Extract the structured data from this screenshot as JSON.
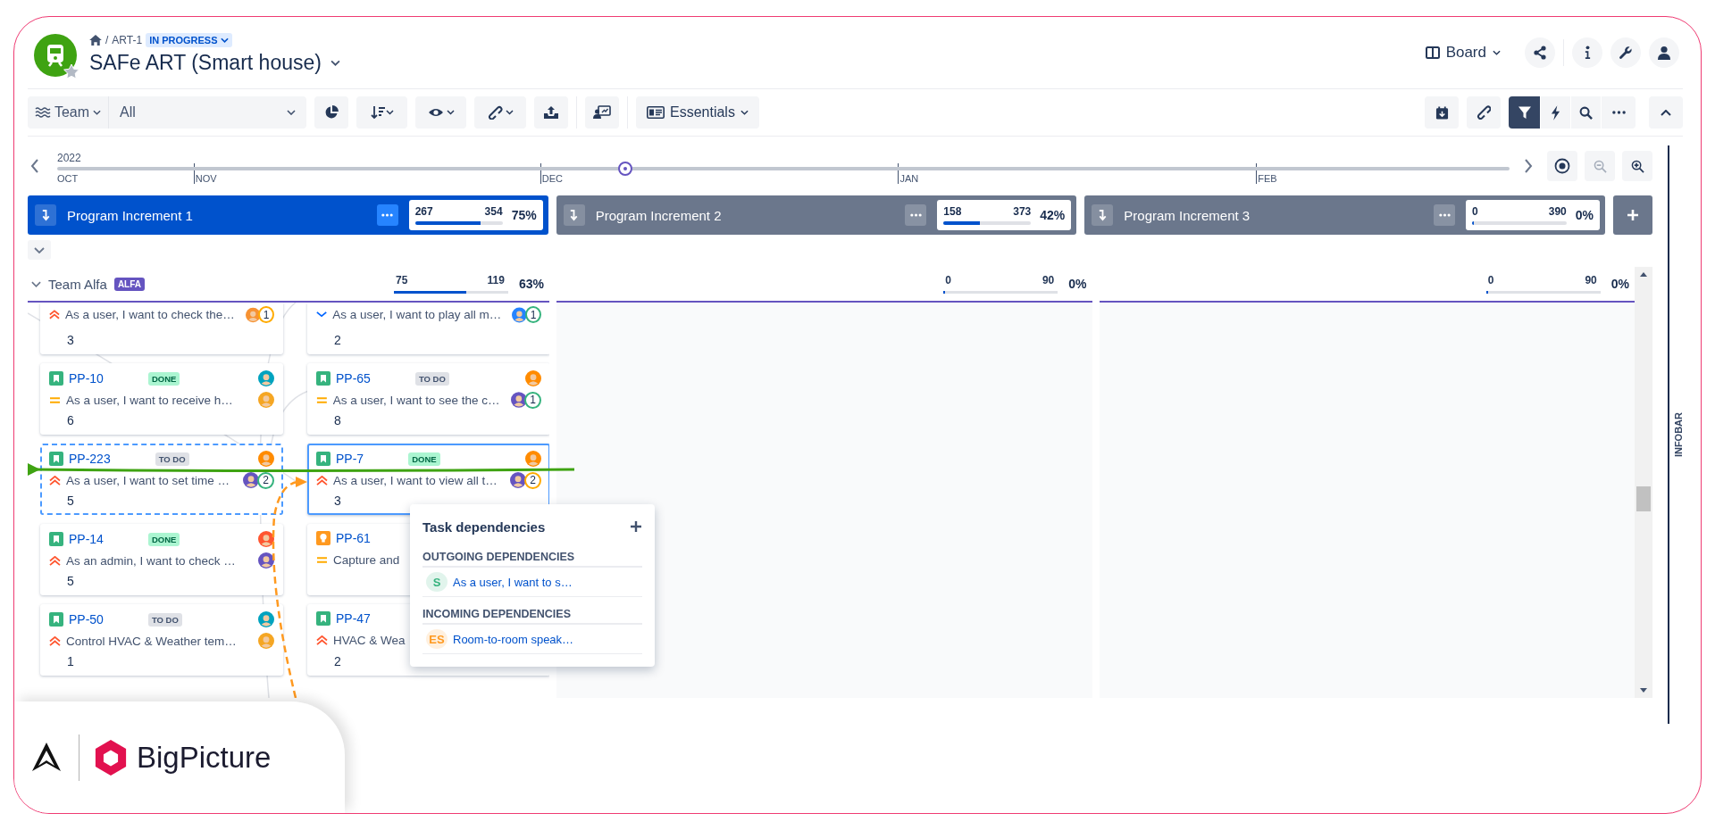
{
  "header": {
    "home_separator": "/",
    "breadcrumb": "ART-1",
    "status": "IN PROGRESS",
    "title": "SAFe ART (Smart house)",
    "view": "Board"
  },
  "toolbar": {
    "group_by": "Team",
    "filter_value": "All",
    "preset": "Essentials",
    "filter_on": true
  },
  "timeline": {
    "year": "2022",
    "months": [
      "OCT",
      "NOV",
      "DEC",
      "JAN",
      "FEB"
    ]
  },
  "increments": [
    {
      "title": "Program Increment 1",
      "done": "267",
      "total": "354",
      "percent": "75%",
      "level": 0.75,
      "selected": true
    },
    {
      "title": "Program Increment 2",
      "done": "158",
      "total": "373",
      "percent": "42%",
      "level": 0.42,
      "selected": false
    },
    {
      "title": "Program Increment 3",
      "done": "0",
      "total": "390",
      "percent": "0%",
      "level": 0,
      "selected": false
    }
  ],
  "team": {
    "name": "Team Alfa",
    "badge": "ALFA",
    "stats": [
      {
        "done": "75",
        "total": "119",
        "percent": "63%",
        "level": 0.63
      },
      {
        "done": "0",
        "total": "90",
        "percent": "0%",
        "level": 0
      },
      {
        "done": "0",
        "total": "90",
        "percent": "0%",
        "level": 0
      }
    ]
  },
  "columns": [
    {
      "cards": [
        {
          "priority": {
            "kind": "highest"
          },
          "summary": "As a user, I want to check the…",
          "points": "3",
          "line_avatar": {
            "color": "#f79232"
          },
          "badge": {
            "text": "1",
            "color": "#ffab00"
          },
          "selected": false,
          "marked": false
        },
        {
          "id": "PP-10",
          "kind": "story",
          "status": {
            "text": "DONE",
            "kind": "done"
          },
          "priority": {
            "kind": "medium"
          },
          "summary": "As a user, I want to receive h…",
          "points": "6",
          "head_avatar": {
            "color": "#00a3bf"
          },
          "line_avatar": {
            "color": "#f5a623"
          },
          "selected": false,
          "marked": false
        },
        {
          "id": "PP-223",
          "kind": "story",
          "status": {
            "text": "TO DO",
            "kind": "todo"
          },
          "priority": {
            "kind": "highest"
          },
          "summary": "As a user, I want to set time …",
          "points": "5",
          "head_avatar": {
            "color": "#ff8b00"
          },
          "line_avatar": {
            "color": "#6554c0"
          },
          "badge": {
            "text": "2",
            "color": "#36b37e"
          },
          "selected": false,
          "marked": true
        },
        {
          "id": "PP-14",
          "kind": "story",
          "status": {
            "text": "DONE",
            "kind": "done"
          },
          "priority": {
            "kind": "highest"
          },
          "summary": "As an admin, I want to check …",
          "points": "5",
          "head_avatar": {
            "color": "#ff5630"
          },
          "line_avatar": {
            "color": "#6554c0"
          },
          "selected": false,
          "marked": false
        },
        {
          "id": "PP-50",
          "kind": "story",
          "status": {
            "text": "TO DO",
            "kind": "todo"
          },
          "priority": {
            "kind": "highest"
          },
          "summary": "Control HVAC & Weather tem…",
          "points": "1",
          "head_avatar": {
            "color": "#00a3bf"
          },
          "line_avatar": {
            "color": "#f5a623"
          },
          "selected": false,
          "marked": false
        }
      ]
    },
    {
      "cards": [
        {
          "priority": {
            "kind": "low"
          },
          "summary": "As a user, I want to play all m…",
          "points": "2",
          "line_avatar": {
            "color": "#2684ff"
          },
          "badge": {
            "text": "1",
            "color": "#36b37e"
          },
          "selected": false,
          "marked": false
        },
        {
          "id": "PP-65",
          "kind": "story",
          "status": {
            "text": "TO DO",
            "kind": "todo"
          },
          "priority": {
            "kind": "medium"
          },
          "summary": "As a user, I want to see the c…",
          "points": "8",
          "head_avatar": {
            "color": "#ff8b00"
          },
          "line_avatar": {
            "color": "#6554c0"
          },
          "badge": {
            "text": "1",
            "color": "#36b37e"
          },
          "selected": false,
          "marked": false
        },
        {
          "id": "PP-7",
          "kind": "story",
          "status": {
            "text": "DONE",
            "kind": "done"
          },
          "priority": {
            "kind": "highest"
          },
          "summary": "As a user, I want to view all t…",
          "points": "3",
          "head_avatar": {
            "color": "#ff8b00"
          },
          "line_avatar": {
            "color": "#6554c0"
          },
          "badge": {
            "text": "2",
            "color": "#ffab00"
          },
          "selected": true,
          "marked": false
        },
        {
          "id": "PP-61",
          "kind": "idea",
          "priority": {
            "kind": "medium"
          },
          "summary": "Capture and",
          "selected": false,
          "marked": false
        },
        {
          "id": "PP-47",
          "kind": "story",
          "priority": {
            "kind": "highest"
          },
          "summary": "HVAC & Wea",
          "points": "2",
          "selected": false,
          "marked": false
        }
      ]
    }
  ],
  "popup": {
    "title": "Task dependencies",
    "sections": [
      {
        "heading": "OUTGOING DEPENDENCIES",
        "items": [
          {
            "badge": "S",
            "text": "As a user, I want to s…",
            "color": "#36b37e"
          }
        ]
      },
      {
        "heading": "INCOMING DEPENDENCIES",
        "items": [
          {
            "badge": "ES",
            "text": "Room-to-room speak…",
            "color": "#ff991f"
          }
        ]
      }
    ]
  },
  "infobar": "INFOBAR",
  "brand": "BigPicture"
}
